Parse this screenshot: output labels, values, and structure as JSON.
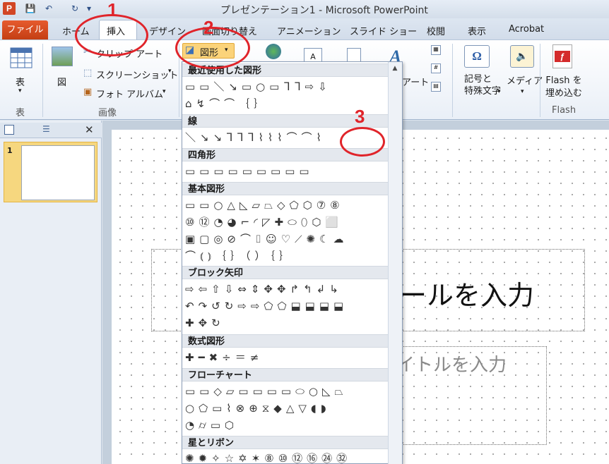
{
  "app": {
    "icon_letter": "P",
    "title": "プレゼンテーション1 - Microsoft PowerPoint"
  },
  "qat": [
    "💾",
    "↶",
    "↻",
    "▾"
  ],
  "tabs": [
    "ファイル",
    "ホーム",
    "挿入",
    "デザイン",
    "画面切り替え",
    "アニメーション",
    "スライド ショー",
    "校閲",
    "表示",
    "Acrobat"
  ],
  "ribbon": {
    "table": {
      "label": "表",
      "group": "表"
    },
    "images": {
      "picture": "図",
      "clipart": "クリップ アート",
      "screenshot": "スクリーンショット",
      "album": "フォト アルバム",
      "group": "画像"
    },
    "shapes_button": "図形",
    "art_partial": "アート",
    "symbol": "記号と\n特殊文字",
    "media": "メディア",
    "flash": {
      "label": "Flash を\n埋め込む",
      "group": "Flash"
    }
  },
  "dropdown": {
    "sections": [
      {
        "title": "最近使用した図形",
        "rows": [
          "▭▭＼↘▭○▭ᒣᒣ⇨⇩",
          "⌂↯⌒⌒｛｝"
        ]
      },
      {
        "title": "線",
        "rows": [
          "＼↘↘ᒣᒣᒣ⌇⌇⌇⌒⌒⌇"
        ]
      },
      {
        "title": "四角形",
        "rows": [
          "▭▭▭▭▭▭▭▭▭"
        ]
      },
      {
        "title": "基本図形",
        "rows": [
          "▭▭○△◺▱⏢◇⬠⬡⑦⑧",
          "⑩⑫◔◕⌐◜◸✚⬭⬯⬡⬜",
          "▣▢◎⊘⌒⌷☺♡⟋✺☾☁",
          "⌒⦅⦆｛｝（）｛｝"
        ]
      },
      {
        "title": "ブロック矢印",
        "rows": [
          "⇨⇦⇧⇩⇔⇕✥✥↱↰↲↳",
          "↶↷↺↻⇨⇨⬠⬠⬓⬓⬓⬓",
          "✚✥↻"
        ]
      },
      {
        "title": "数式図形",
        "rows": [
          "✚━✖÷＝≠"
        ]
      },
      {
        "title": "フローチャート",
        "rows": [
          "▭▭◇▱▭▭▭▭⬭○◺⏢",
          "○⬠▭⌇⊗⊕⧖◆△▽◖◗",
          "◔⌭▭⬡"
        ]
      },
      {
        "title": "星とリボン",
        "rows": [
          "✺✹✧☆✡✶⑧⑩⑫⑯㉔㉜"
        ]
      }
    ]
  },
  "slide": {
    "thumb_number": "1",
    "title_placeholder": "ールを入力",
    "subtitle_placeholder": "イトルを入力"
  },
  "annotations": [
    "1",
    "2",
    "3"
  ],
  "colors": {
    "file_tab": "#d04a1f",
    "annotation": "#e0242a",
    "shapes_highlight": "#fbd37a"
  }
}
